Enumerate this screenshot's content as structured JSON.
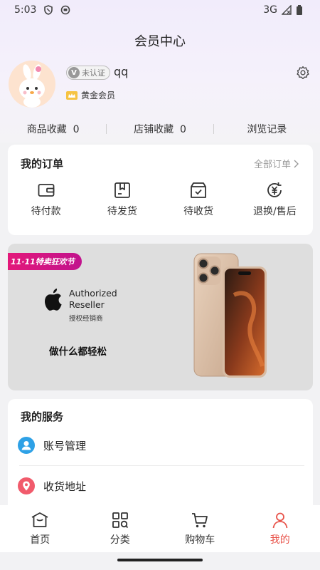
{
  "status_bar": {
    "time": "5:03",
    "network": "3G"
  },
  "header": {
    "title": "会员中心"
  },
  "profile": {
    "verify_label": "未认证",
    "verify_icon": "V",
    "username": "qq",
    "member_level": "黄金会员"
  },
  "stats": [
    {
      "label": "商品收藏",
      "count": "0"
    },
    {
      "label": "店铺收藏",
      "count": "0"
    },
    {
      "label": "浏览记录"
    }
  ],
  "orders": {
    "title": "我的订单",
    "all_label": "全部订单",
    "items": [
      {
        "label": "待付款",
        "icon": "wallet-icon"
      },
      {
        "label": "待发货",
        "icon": "package-icon"
      },
      {
        "label": "待收货",
        "icon": "delivery-box-icon"
      },
      {
        "label": "退换/售后",
        "icon": "refund-icon"
      }
    ]
  },
  "banner": {
    "promo_tag": "11·11特卖狂欢节",
    "reseller_line1": "Authorized",
    "reseller_line2": "Reseller",
    "reseller_cn": "授权经销商",
    "slogan": "做什么都轻松"
  },
  "services": {
    "title": "我的服务",
    "items": [
      {
        "label": "账号管理",
        "icon": "account-icon",
        "color": "#2ea1e6"
      },
      {
        "label": "收货地址",
        "icon": "location-icon",
        "color": "#f15b6c"
      }
    ]
  },
  "tabbar": {
    "items": [
      {
        "label": "首页",
        "icon": "home-icon"
      },
      {
        "label": "分类",
        "icon": "category-icon"
      },
      {
        "label": "购物车",
        "icon": "cart-icon"
      },
      {
        "label": "我的",
        "icon": "profile-icon",
        "active": true
      }
    ],
    "active_color": "#e8534a"
  }
}
